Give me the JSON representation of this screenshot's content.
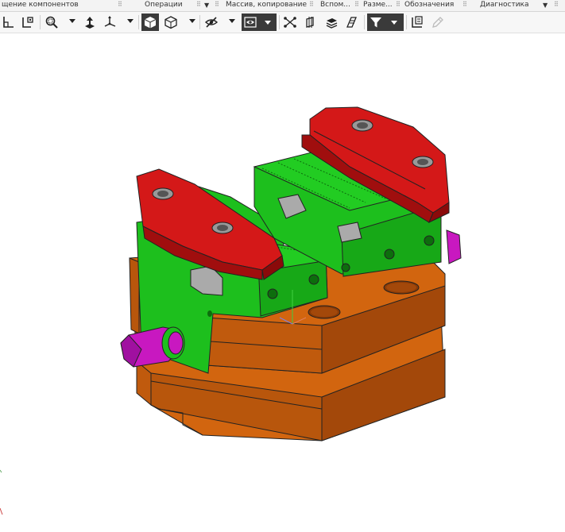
{
  "tabs": [
    {
      "label": "щение компонентов"
    },
    {
      "label": "Операции"
    },
    {
      "label": "Массив, копирование"
    },
    {
      "label": "Вспом..."
    },
    {
      "label": "Разме..."
    },
    {
      "label": "Обозначения"
    },
    {
      "label": "Диагностика"
    }
  ],
  "toolbar_icons": [
    "sketch-profile-icon",
    "sketch-dimension-icon",
    "zoom-icon",
    "move-part-icon",
    "coordinate-axes-icon",
    "shaded-solid-icon",
    "shaded-wireframe-icon",
    "hide-icon",
    "visibility-icon",
    "snap-icon",
    "section-icon",
    "layers-icon",
    "properties-icon",
    "filter-icon",
    "report-icon",
    "pencil-disabled-icon"
  ],
  "colors": {
    "base": "#d2650f",
    "base_dark": "#a3480a",
    "body_green": "#1dbf1d",
    "body_green_dark": "#128f12",
    "jaw_red": "#d41818",
    "jaw_red_dark": "#a00e0e",
    "screw_magenta": "#c818c0",
    "toolbar_dark": "#3a3a3a"
  }
}
